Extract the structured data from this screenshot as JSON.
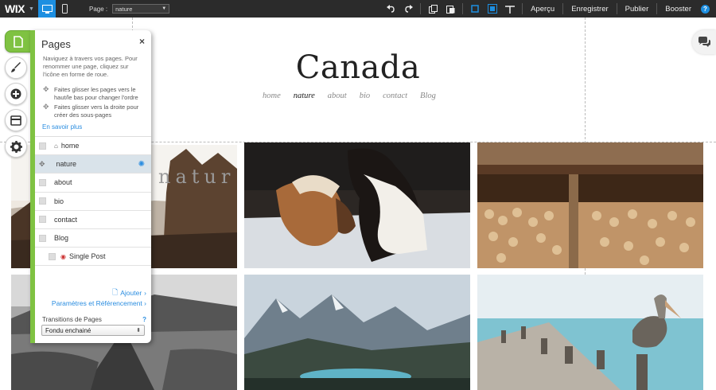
{
  "topbar": {
    "logo": "WIX",
    "page_label": "Page :",
    "page_value": "nature",
    "menu": [
      "Aperçu",
      "Enregistrer",
      "Publier",
      "Booster"
    ],
    "help": "?",
    "accent": "#1d8fe1"
  },
  "site": {
    "title": "Canada",
    "nav": [
      "home",
      "nature",
      "about",
      "bio",
      "contact",
      "Blog"
    ],
    "current": "nature",
    "overlay_word": "natur"
  },
  "panel": {
    "title": "Pages",
    "close": "×",
    "description": "Naviguez à travers vos pages. Pour renommer une page, cliquez sur l'icône en forme de roue.",
    "hint_reorder": "Faites glisser les pages vers le haut/le bas pour changer l'ordre",
    "hint_subpage": "Faites glisser vers la droite pour créer des sous-pages",
    "learn_more": "En savoir plus",
    "pages": [
      "home",
      "nature",
      "about",
      "bio",
      "contact",
      "Blog",
      "Single Post"
    ],
    "selected": "nature",
    "add": "Ajouter",
    "params": "Paramètres et Référencement",
    "transitions_label": "Transitions de Pages",
    "transitions_help": "?",
    "transition_value": "Fondu enchainé",
    "accent_green": "#7fc242"
  }
}
